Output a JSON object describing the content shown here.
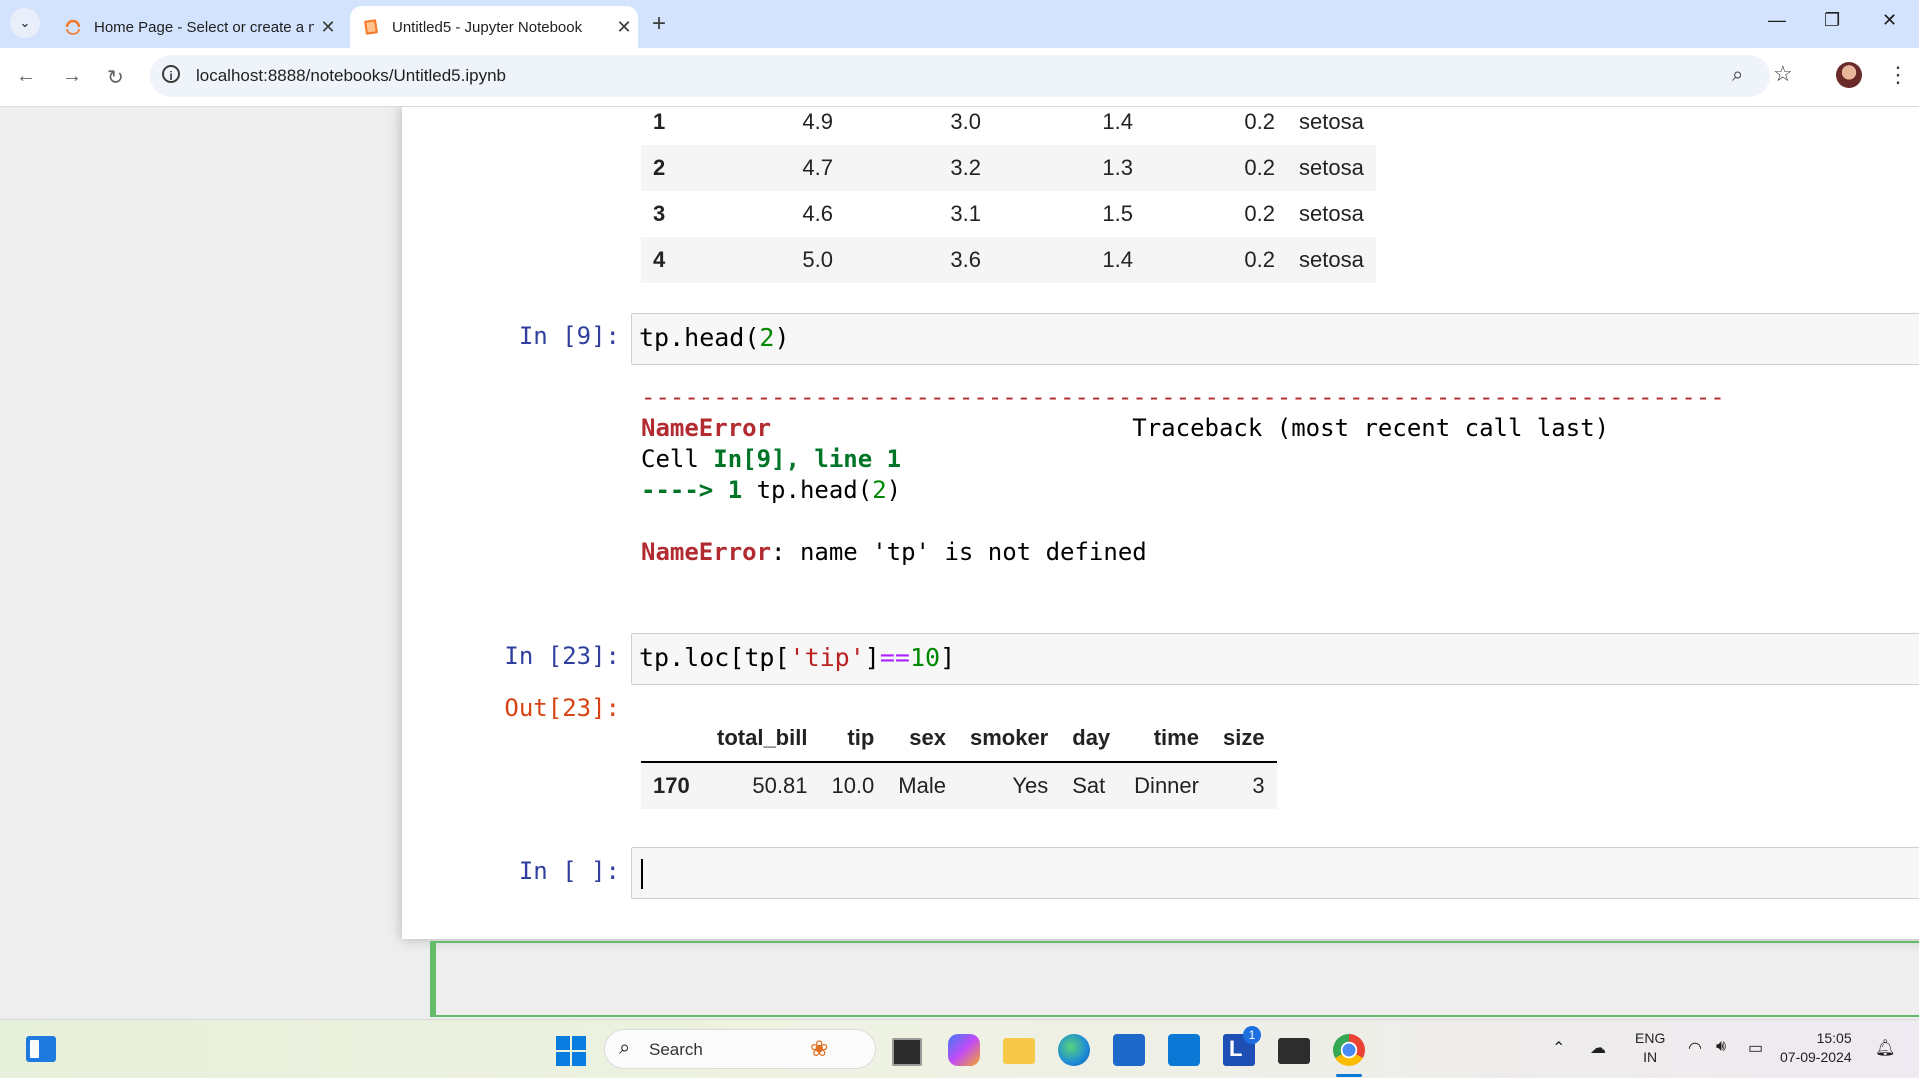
{
  "browser": {
    "tabs": [
      {
        "title": "Home Page - Select or create a notebook",
        "active": false
      },
      {
        "title": "Untitled5 - Jupyter Notebook",
        "active": true
      }
    ],
    "new_tab_label": "+",
    "address": "localhost:8888/notebooks/Untitled5.ipynb"
  },
  "notebook": {
    "iris_rows": [
      {
        "idx": "1",
        "c1": "4.9",
        "c2": "3.0",
        "c3": "1.4",
        "c4": "0.2",
        "species": "setosa"
      },
      {
        "idx": "2",
        "c1": "4.7",
        "c2": "3.2",
        "c3": "1.3",
        "c4": "0.2",
        "species": "setosa"
      },
      {
        "idx": "3",
        "c1": "4.6",
        "c2": "3.1",
        "c3": "1.5",
        "c4": "0.2",
        "species": "setosa"
      },
      {
        "idx": "4",
        "c1": "5.0",
        "c2": "3.6",
        "c3": "1.4",
        "c4": "0.2",
        "species": "setosa"
      }
    ],
    "cell9": {
      "prompt": "In [9]:",
      "code_pre": "tp.head(",
      "code_num": "2",
      "code_post": ")"
    },
    "error": {
      "dashes": "---------------------------------------------------------------------------",
      "name": "NameError",
      "traceback": "Traceback (most recent call last)",
      "cell_prefix": "Cell ",
      "cell_ref": "In[9], line 1",
      "arrow": "----> 1",
      "line_code_pre": " tp.head(",
      "line_code_num": "2",
      "line_code_post": ")",
      "message": ": name 'tp' is not defined"
    },
    "cell23": {
      "prompt": "In [23]:",
      "out_prompt": "Out[23]:",
      "code_a": "tp.loc[tp[",
      "code_str": "'tip'",
      "code_b": "]",
      "code_op": "==",
      "code_num": "10",
      "code_c": "]"
    },
    "tips_table": {
      "headers": [
        "total_bill",
        "tip",
        "sex",
        "smoker",
        "day",
        "time",
        "size"
      ],
      "row": {
        "idx": "170",
        "values": [
          "50.81",
          "10.0",
          "Male",
          "Yes",
          "Sat",
          "Dinner",
          "3"
        ]
      }
    },
    "empty_cell_prompt": "In [ ]:"
  },
  "taskbar": {
    "search_label": "Search",
    "lang_top": "ENG",
    "lang_bottom": "IN",
    "time": "15:05",
    "date": "07-09-2024",
    "badge": "1"
  }
}
